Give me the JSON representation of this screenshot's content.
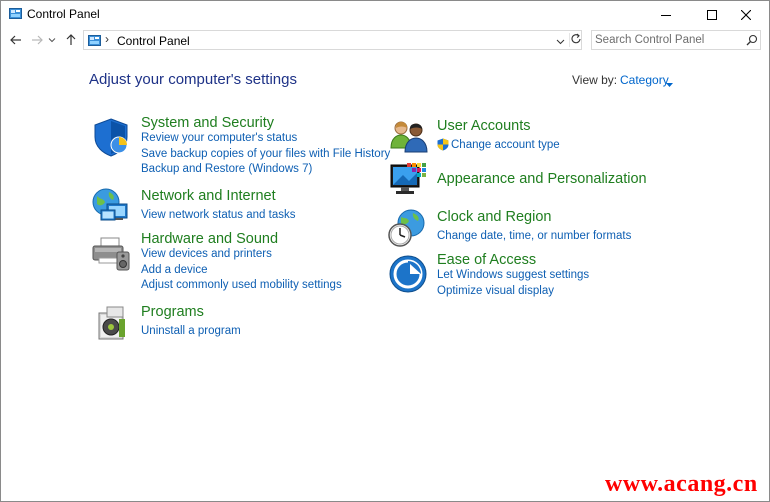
{
  "window": {
    "title": "Control Panel"
  },
  "address_bar": {
    "breadcrumb": "Control Panel",
    "separator": "›",
    "search_placeholder": "Search Control Panel"
  },
  "main": {
    "heading": "Adjust your computer's settings",
    "view_by_label": "View by:",
    "view_by_value": "Category"
  },
  "categories": {
    "system_security": {
      "title": "System and Security",
      "links": [
        "Review your computer's status",
        "Save backup copies of your files with File History",
        "Backup and Restore (Windows 7)"
      ]
    },
    "network": {
      "title": "Network and Internet",
      "links": [
        "View network status and tasks"
      ]
    },
    "hardware": {
      "title": "Hardware and Sound",
      "links": [
        "View devices and printers",
        "Add a device",
        "Adjust commonly used mobility settings"
      ]
    },
    "programs": {
      "title": "Programs",
      "links": [
        "Uninstall a program"
      ]
    },
    "user_accounts": {
      "title": "User Accounts",
      "links": [
        "Change account type"
      ]
    },
    "appearance": {
      "title": "Appearance and Personalization",
      "links": []
    },
    "clock": {
      "title": "Clock and Region",
      "links": [
        "Change date, time, or number formats"
      ]
    },
    "ease": {
      "title": "Ease of Access",
      "links": [
        "Let Windows suggest settings",
        "Optimize visual display"
      ]
    }
  },
  "watermark": "www.acang.cn",
  "colors": {
    "category_title": "#1f7e1f",
    "link": "#0e5fb3",
    "heading": "#1e3287",
    "watermark": "#ff0000"
  }
}
